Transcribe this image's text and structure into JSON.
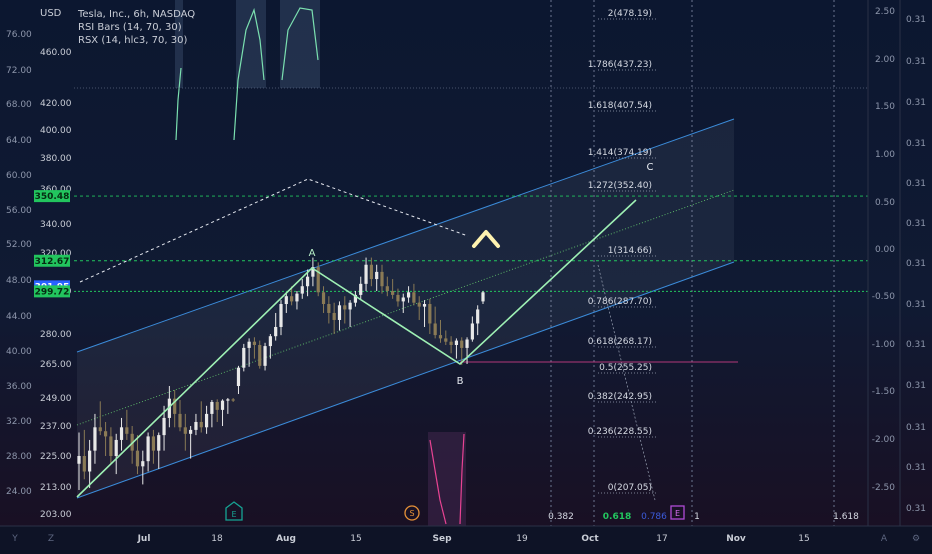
{
  "legend": {
    "currency": "USD",
    "title": "Tesla, Inc., 6h, NASDAQ",
    "line2": "RSI Bars (14, 70, 30)",
    "line3": "RSX (14, hlc3, 70, 30)"
  },
  "chart_data": {
    "type": "candlestick",
    "main_axis_ticks": [
      460.0,
      420.0,
      400.0,
      380.0,
      360.0,
      340.0,
      320.0,
      300.0,
      280.0,
      265.0,
      249.0,
      237.0,
      225.0,
      213.0,
      203.0
    ],
    "outer_left_ticks": [
      "76.00",
      "72.00",
      "68.00",
      "64.00",
      "60.00",
      "56.00",
      "52.00",
      "48.00",
      "44.00",
      "40.00",
      "36.00",
      "32.00",
      "28.00",
      "24.00"
    ],
    "right_axis1_ticks": [
      "2.50",
      "2.00",
      "1.50",
      "1.00",
      "0.50",
      "0.00",
      "-0.50",
      "-1.00",
      "-1.50",
      "-2.00",
      "-2.50"
    ],
    "right_axis2_ticks": [
      "0.31",
      "0.31",
      "0.31",
      "0.31",
      "0.31",
      "0.31",
      "0.31",
      "0.31",
      "0.31",
      "0.31",
      "0.31",
      "0.31",
      "0.31"
    ],
    "price_labels": [
      {
        "label": "350.48",
        "value": 350.48,
        "color": "#22c55e"
      },
      {
        "label": "312.67",
        "value": 312.67,
        "color": "#22c55e"
      },
      {
        "label": "301.95",
        "value": 301.95,
        "color": "#2962ff"
      },
      {
        "label": "299.72",
        "value": 299.72,
        "color": "#22c55e"
      }
    ],
    "x_axis_labels": [
      "Y",
      "Z",
      "Jul",
      "18",
      "Aug",
      "15",
      "Sep",
      "19",
      "Oct",
      "17",
      "Nov",
      "15"
    ],
    "fib_levels": [
      {
        "label": "2(478.19)",
        "value": 478.19
      },
      {
        "label": "1.786(437.23)",
        "value": 437.23
      },
      {
        "label": "1.618(407.54)",
        "value": 407.54
      },
      {
        "label": "1.414(374.19)",
        "value": 374.19
      },
      {
        "label": "1.272(352.40)",
        "value": 352.4
      },
      {
        "label": "1(314.66)",
        "value": 314.66
      },
      {
        "label": "0.786(287.70)",
        "value": 287.7
      },
      {
        "label": "0.618(268.17)",
        "value": 268.17
      },
      {
        "label": "0.5(255.25)",
        "value": 255.25
      },
      {
        "label": "0.382(242.95)",
        "value": 242.95
      },
      {
        "label": "0.236(228.55)",
        "value": 228.55
      },
      {
        "label": "0(207.05)",
        "value": 207.05
      }
    ],
    "time_fib_labels": [
      "0.382",
      "0.618",
      "0.786",
      "1",
      "1.618"
    ],
    "pattern_points": [
      {
        "label": "A",
        "date": "Aug 5",
        "value": 313
      },
      {
        "label": "B",
        "date": "Sep 5",
        "value": 267
      },
      {
        "label": "C",
        "date": "Oct 13",
        "value": 352
      }
    ],
    "markers": [
      "E",
      "S",
      "E"
    ],
    "candles": [
      {
        "o": 222,
        "h": 232,
        "l": 210,
        "c": 225
      },
      {
        "o": 225,
        "h": 234,
        "l": 216,
        "c": 219
      },
      {
        "o": 219,
        "h": 228,
        "l": 212,
        "c": 226
      },
      {
        "o": 226,
        "h": 240,
        "l": 222,
        "c": 236
      },
      {
        "o": 236,
        "h": 244,
        "l": 230,
        "c": 233
      },
      {
        "o": 233,
        "h": 238,
        "l": 225,
        "c": 229
      },
      {
        "o": 229,
        "h": 236,
        "l": 222,
        "c": 225
      },
      {
        "o": 225,
        "h": 231,
        "l": 218,
        "c": 228
      },
      {
        "o": 228,
        "h": 239,
        "l": 226,
        "c": 236
      },
      {
        "o": 236,
        "h": 241,
        "l": 228,
        "c": 231
      },
      {
        "o": 231,
        "h": 237,
        "l": 222,
        "c": 226
      },
      {
        "o": 226,
        "h": 230,
        "l": 218,
        "c": 221
      },
      {
        "o": 221,
        "h": 226,
        "l": 214,
        "c": 223
      },
      {
        "o": 223,
        "h": 232,
        "l": 219,
        "c": 229
      },
      {
        "o": 229,
        "h": 234,
        "l": 222,
        "c": 226
      },
      {
        "o": 226,
        "h": 232,
        "l": 220,
        "c": 230
      },
      {
        "o": 230,
        "h": 242,
        "l": 226,
        "c": 239
      },
      {
        "o": 239,
        "h": 252,
        "l": 236,
        "c": 248
      },
      {
        "o": 248,
        "h": 251,
        "l": 236,
        "c": 240
      },
      {
        "o": 240,
        "h": 246,
        "l": 233,
        "c": 236
      },
      {
        "o": 236,
        "h": 240,
        "l": 226,
        "c": 231
      },
      {
        "o": 231,
        "h": 237,
        "l": 224,
        "c": 234
      },
      {
        "o": 234,
        "h": 240,
        "l": 230,
        "c": 238
      },
      {
        "o": 238,
        "h": 244,
        "l": 232,
        "c": 236
      },
      {
        "o": 236,
        "h": 242,
        "l": 231,
        "c": 240
      },
      {
        "o": 240,
        "h": 246,
        "l": 236,
        "c": 243
      },
      {
        "o": 243,
        "h": 247,
        "l": 238,
        "c": 241
      },
      {
        "o": 241,
        "h": 247,
        "l": 237,
        "c": 245
      },
      {
        "o": 245,
        "h": 249,
        "l": 240,
        "c": 247
      },
      {
        "o": 247,
        "h": 249,
        "l": 243,
        "c": 245
      },
      {
        "o": 252,
        "h": 263,
        "l": 250,
        "c": 261
      },
      {
        "o": 261,
        "h": 271,
        "l": 257,
        "c": 268
      },
      {
        "o": 268,
        "h": 276,
        "l": 262,
        "c": 273
      },
      {
        "o": 273,
        "h": 277,
        "l": 266,
        "c": 270
      },
      {
        "o": 270,
        "h": 274,
        "l": 260,
        "c": 263
      },
      {
        "o": 263,
        "h": 272,
        "l": 258,
        "c": 269
      },
      {
        "o": 269,
        "h": 280,
        "l": 266,
        "c": 278
      },
      {
        "o": 278,
        "h": 286,
        "l": 274,
        "c": 282
      },
      {
        "o": 282,
        "h": 293,
        "l": 279,
        "c": 290
      },
      {
        "o": 290,
        "h": 299,
        "l": 286,
        "c": 296
      },
      {
        "o": 296,
        "h": 302,
        "l": 289,
        "c": 292
      },
      {
        "o": 292,
        "h": 300,
        "l": 287,
        "c": 298
      },
      {
        "o": 298,
        "h": 305,
        "l": 294,
        "c": 302
      },
      {
        "o": 302,
        "h": 309,
        "l": 296,
        "c": 306
      },
      {
        "o": 306,
        "h": 314,
        "l": 302,
        "c": 310
      },
      {
        "o": 310,
        "h": 312,
        "l": 296,
        "c": 299
      },
      {
        "o": 299,
        "h": 302,
        "l": 286,
        "c": 290
      },
      {
        "o": 290,
        "h": 296,
        "l": 283,
        "c": 286
      },
      {
        "o": 286,
        "h": 291,
        "l": 280,
        "c": 284
      },
      {
        "o": 284,
        "h": 292,
        "l": 281,
        "c": 289
      },
      {
        "o": 289,
        "h": 296,
        "l": 283,
        "c": 287
      },
      {
        "o": 287,
        "h": 293,
        "l": 282,
        "c": 291
      },
      {
        "o": 291,
        "h": 300,
        "l": 288,
        "c": 297
      },
      {
        "o": 297,
        "h": 306,
        "l": 293,
        "c": 303
      },
      {
        "o": 303,
        "h": 314,
        "l": 300,
        "c": 311
      },
      {
        "o": 311,
        "h": 314,
        "l": 302,
        "c": 305
      },
      {
        "o": 305,
        "h": 311,
        "l": 300,
        "c": 308
      },
      {
        "o": 308,
        "h": 311,
        "l": 298,
        "c": 302
      },
      {
        "o": 302,
        "h": 306,
        "l": 296,
        "c": 300
      },
      {
        "o": 300,
        "h": 305,
        "l": 294,
        "c": 297
      },
      {
        "o": 297,
        "h": 301,
        "l": 288,
        "c": 292
      },
      {
        "o": 292,
        "h": 298,
        "l": 286,
        "c": 295
      },
      {
        "o": 295,
        "h": 302,
        "l": 291,
        "c": 299
      },
      {
        "o": 299,
        "h": 303,
        "l": 289,
        "c": 291
      },
      {
        "o": 291,
        "h": 296,
        "l": 284,
        "c": 288
      },
      {
        "o": 288,
        "h": 293,
        "l": 282,
        "c": 290
      },
      {
        "o": 290,
        "h": 294,
        "l": 280,
        "c": 283
      },
      {
        "o": 283,
        "h": 288,
        "l": 276,
        "c": 279
      },
      {
        "o": 279,
        "h": 284,
        "l": 272,
        "c": 276
      },
      {
        "o": 276,
        "h": 281,
        "l": 270,
        "c": 273
      },
      {
        "o": 273,
        "h": 278,
        "l": 267,
        "c": 270
      },
      {
        "o": 270,
        "h": 276,
        "l": 266,
        "c": 274
      },
      {
        "o": 274,
        "h": 277,
        "l": 264,
        "c": 268
      },
      {
        "o": 268,
        "h": 277,
        "l": 265,
        "c": 275
      },
      {
        "o": 275,
        "h": 285,
        "l": 273,
        "c": 283
      },
      {
        "o": 283,
        "h": 289,
        "l": 279,
        "c": 287
      },
      {
        "o": 292,
        "h": 300,
        "l": 290,
        "c": 299
      }
    ],
    "ylim": [
      203,
      470
    ],
    "grid": true
  }
}
